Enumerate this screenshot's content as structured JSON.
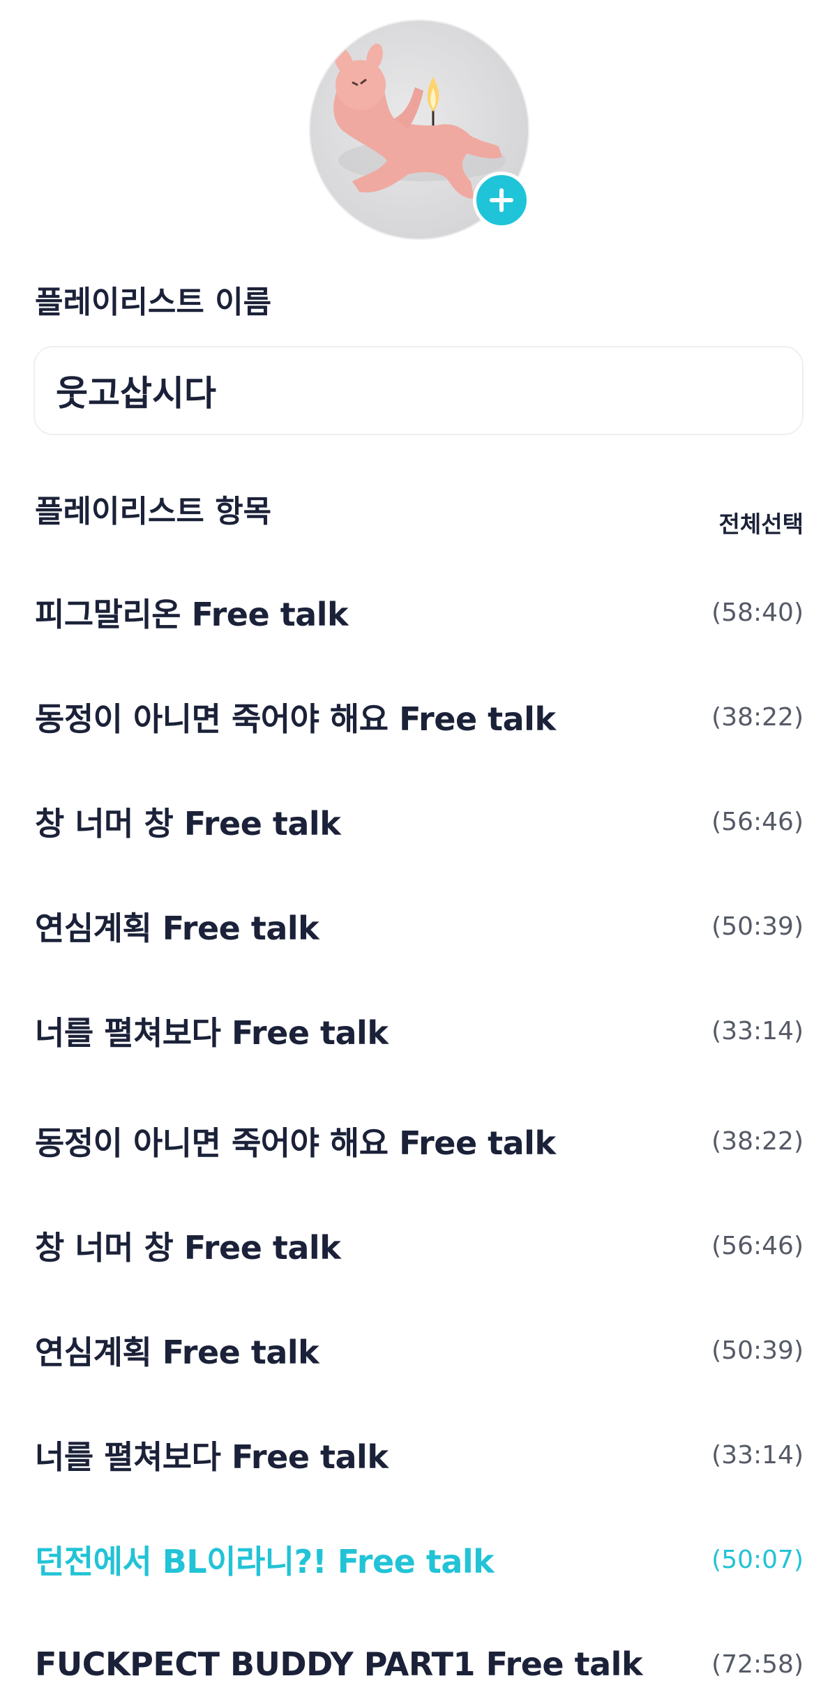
{
  "cover": {
    "image_desc_icon": "candle-bunny-photo",
    "add_icon": "plus-icon"
  },
  "playlist_name": {
    "label": "플레이리스트 이름",
    "value": "웃고삽시다"
  },
  "playlist_items": {
    "label": "플레이리스트 항목",
    "select_all_label": "전체선택",
    "accent_color": "#22c3d6",
    "tracks": [
      {
        "title": "피그말리온 Free talk",
        "duration": "(58:40)",
        "active": false
      },
      {
        "title": "동정이 아니면 죽어야 해요 Free talk",
        "duration": "(38:22)",
        "active": false
      },
      {
        "title": "창 너머 창 Free talk",
        "duration": "(56:46)",
        "active": false
      },
      {
        "title": "연심계획 Free talk",
        "duration": "(50:39)",
        "active": false
      },
      {
        "title": "너를 펼쳐보다 Free talk",
        "duration": "(33:14)",
        "active": false
      },
      {
        "title": "동정이 아니면 죽어야 해요 Free talk",
        "duration": "(38:22)",
        "active": false
      },
      {
        "title": "창 너머 창 Free talk",
        "duration": "(56:46)",
        "active": false
      },
      {
        "title": "연심계획 Free talk",
        "duration": "(50:39)",
        "active": false
      },
      {
        "title": "너를 펼쳐보다 Free talk",
        "duration": "(33:14)",
        "active": false
      },
      {
        "title": "던전에서 BL이라니?! Free talk",
        "duration": "(50:07)",
        "active": true
      },
      {
        "title": "FUCKPECT BUDDY PART1 Free talk",
        "duration": "(72:58)",
        "active": false
      }
    ]
  }
}
